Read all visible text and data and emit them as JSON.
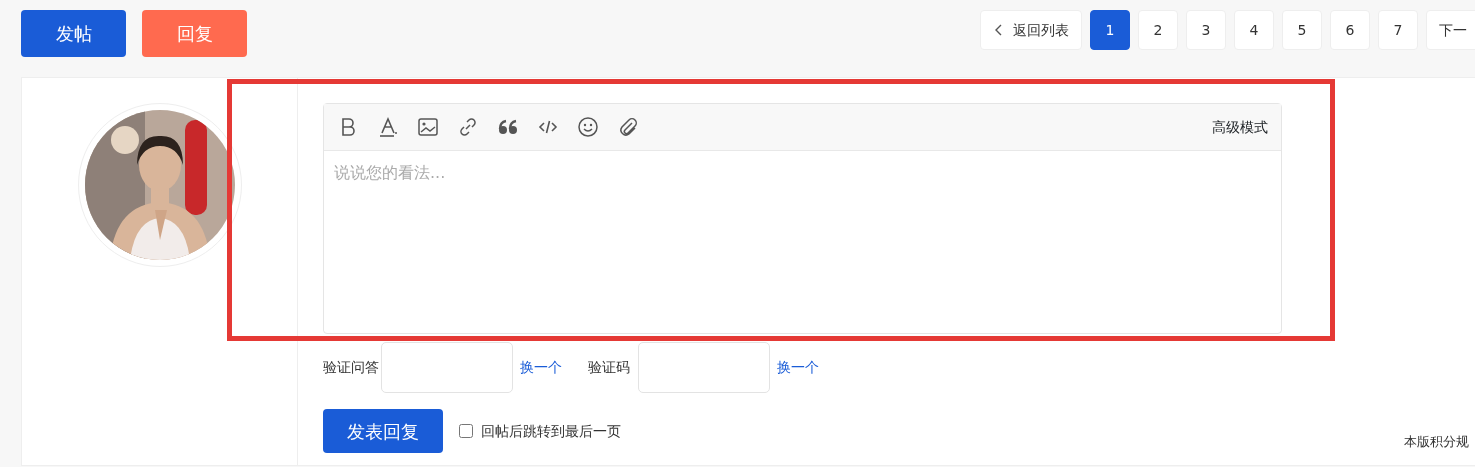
{
  "toolbar": {
    "buttons": [
      {
        "label": "发帖",
        "kind": "primary"
      },
      {
        "label": "回复",
        "kind": "accent"
      }
    ]
  },
  "pagination": {
    "back": "返回列表",
    "pages": [
      {
        "label": "1",
        "selected": true
      },
      {
        "label": "2",
        "selected": false
      },
      {
        "label": "3",
        "selected": false
      },
      {
        "label": "4",
        "selected": false
      },
      {
        "label": "5",
        "selected": false
      },
      {
        "label": "6",
        "selected": false
      },
      {
        "label": "7",
        "selected": false
      }
    ],
    "next": "下一"
  },
  "post": {
    "editor": {
      "mode_link": "高级模式",
      "placeholder": "说说您的看法..."
    },
    "captcha": [
      {
        "label": "验证问答",
        "refresh": "换一个"
      },
      {
        "label": "验证码",
        "refresh": "换一个"
      }
    ],
    "submit": "发表回复",
    "jump_option": {
      "label": "回帖后跳转到最后一页",
      "checked": false
    }
  },
  "footer_text": "本版积分规"
}
